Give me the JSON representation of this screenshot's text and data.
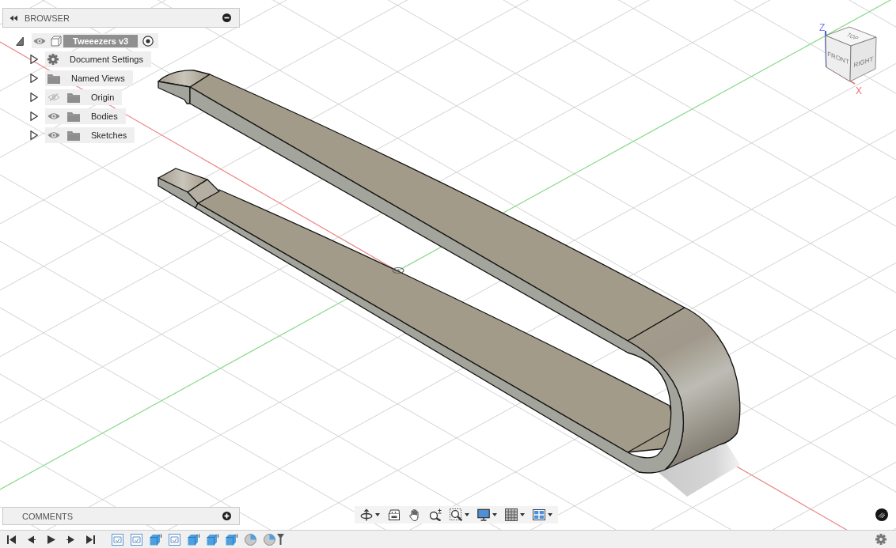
{
  "browser": {
    "title": "BROWSER",
    "root": {
      "label": "Tweeezers v3",
      "expanded": true,
      "visible": true,
      "active": true,
      "children": [
        {
          "kind": "settings",
          "label": "Document Settings",
          "expanded": false
        },
        {
          "kind": "folder",
          "label": "Named Views",
          "expanded": false
        },
        {
          "kind": "folder",
          "label": "Origin",
          "expanded": false,
          "visible": false
        },
        {
          "kind": "folder",
          "label": "Bodies",
          "expanded": false,
          "visible": true
        },
        {
          "kind": "folder",
          "label": "Sketches",
          "expanded": false,
          "visible": true
        }
      ]
    }
  },
  "view_cube": {
    "top": "TOP",
    "front": "FRONT",
    "right": "RIGHT",
    "up_axis": "Z",
    "side_axis": "X"
  },
  "comments": {
    "title": "COMMENTS"
  },
  "navigation_toolbar": [
    {
      "kind": "orbit",
      "dropdown": true
    },
    {
      "kind": "look_at",
      "dropdown": false
    },
    {
      "kind": "pan",
      "dropdown": false
    },
    {
      "kind": "zoom",
      "dropdown": false
    },
    {
      "kind": "fit",
      "dropdown": true
    },
    {
      "kind": "display",
      "dropdown": true
    },
    {
      "kind": "grid",
      "dropdown": true
    },
    {
      "kind": "viewports",
      "dropdown": true
    }
  ],
  "timeline": {
    "controls": [
      {
        "kind": "first"
      },
      {
        "kind": "previous"
      },
      {
        "kind": "play"
      },
      {
        "kind": "next"
      },
      {
        "kind": "last"
      }
    ],
    "features": [
      {
        "kind": "sketch"
      },
      {
        "kind": "sketch"
      },
      {
        "kind": "extrude"
      },
      {
        "kind": "sketch"
      },
      {
        "kind": "extrude"
      },
      {
        "kind": "extrude"
      },
      {
        "kind": "extrude"
      },
      {
        "kind": "fillet"
      },
      {
        "kind": "fillet"
      }
    ]
  }
}
